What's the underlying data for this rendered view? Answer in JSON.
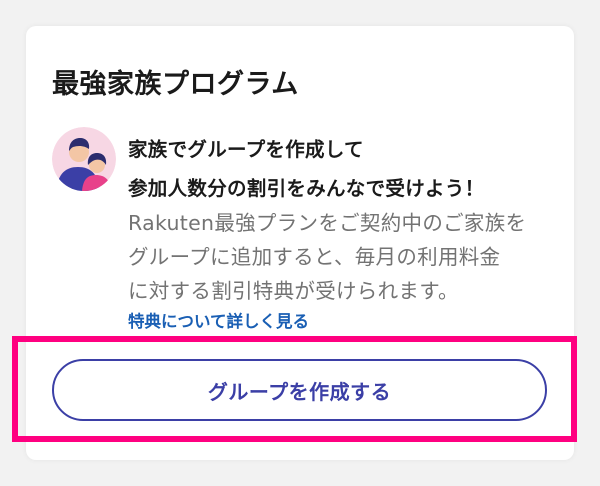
{
  "card": {
    "title": "最強家族プログラム",
    "headline": [
      "家族でグループを作成して",
      "参加人数分の割引をみんなで受けよう！"
    ],
    "description": [
      "Rakuten最強プランをご契約中のご家族を",
      "グループに追加すると、毎月の利用料金",
      "に対する割引特典が受けられます。"
    ],
    "detail_link": "特典について詳しく見る",
    "create_button": "グループを作成する",
    "avatar_icon": "family-avatar-icon"
  },
  "colors": {
    "accent": "#3b3fa6",
    "link": "#1a5fb4",
    "highlight": "#ff0080",
    "avatar_bg": "#f7d7e4"
  }
}
